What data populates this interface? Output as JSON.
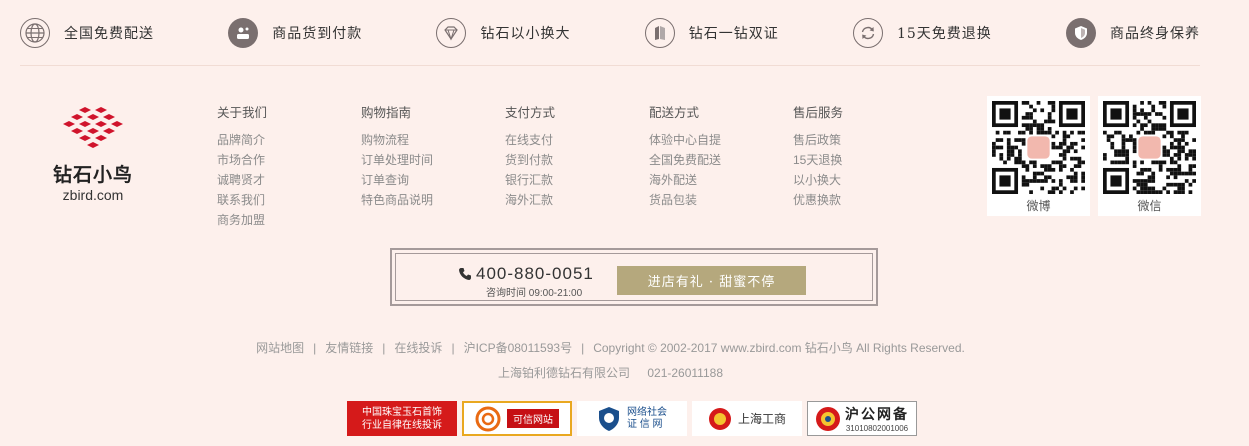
{
  "features": [
    {
      "icon": "globe-icon",
      "label": "全国免费配送"
    },
    {
      "icon": "cash-on-delivery-icon",
      "label": "商品货到付款"
    },
    {
      "icon": "diamond-icon",
      "label": "钻石以小换大"
    },
    {
      "icon": "certificate-book-icon",
      "label": "钻石一钻双证"
    },
    {
      "icon": "refresh-icon",
      "label": "15天免费退换"
    },
    {
      "icon": "shield-icon",
      "label": "商品终身保养"
    }
  ],
  "logo": {
    "cn": "钻石小鸟",
    "en": "zbird.com",
    "color": "#d0142c"
  },
  "columns": [
    {
      "title": "关于我们",
      "links": [
        "品牌简介",
        "市场合作",
        "诚聘贤才",
        "联系我们",
        "商务加盟"
      ]
    },
    {
      "title": "购物指南",
      "links": [
        "购物流程",
        "订单处理时间",
        "订单查询",
        "特色商品说明"
      ]
    },
    {
      "title": "支付方式",
      "links": [
        "在线支付",
        "货到付款",
        "银行汇款",
        "海外汇款"
      ]
    },
    {
      "title": "配送方式",
      "links": [
        "体验中心自提",
        "全国免费配送",
        "海外配送",
        "货品包装"
      ]
    },
    {
      "title": "售后服务",
      "links": [
        "售后政策",
        "15天退换",
        "以小换大",
        "优惠换款"
      ]
    }
  ],
  "qrcodes": [
    {
      "label": "微博"
    },
    {
      "label": "微信"
    }
  ],
  "hotline": {
    "phone": "400-880-0051",
    "hours": "咨询时间 09:00-21:00",
    "button": "进店有礼 · 甜蜜不停"
  },
  "footer": {
    "links": [
      "网站地图",
      "友情链接",
      "在线投诉"
    ],
    "icp": "沪ICP备08011593号",
    "copyright": "Copyright © 2002-2017 www.zbird.com  钻石小鸟  All Rights Reserved.",
    "company": "上海铂利德钻石有限公司",
    "tel": "021-26011188"
  },
  "badges": {
    "b1_line1": "中国珠宝玉石首饰",
    "b1_line2": "行业自律在线投诉",
    "b2": "可信网站",
    "b3_line1": "网络社会",
    "b3_line2": "证 信 网",
    "b4": "上海工商",
    "b5_line1": "沪公网备",
    "b5_line2": "31010802001006"
  },
  "colors": {
    "background": "#fdf0ec",
    "accent_button": "#b5a87d",
    "logo_red": "#d0142c"
  }
}
